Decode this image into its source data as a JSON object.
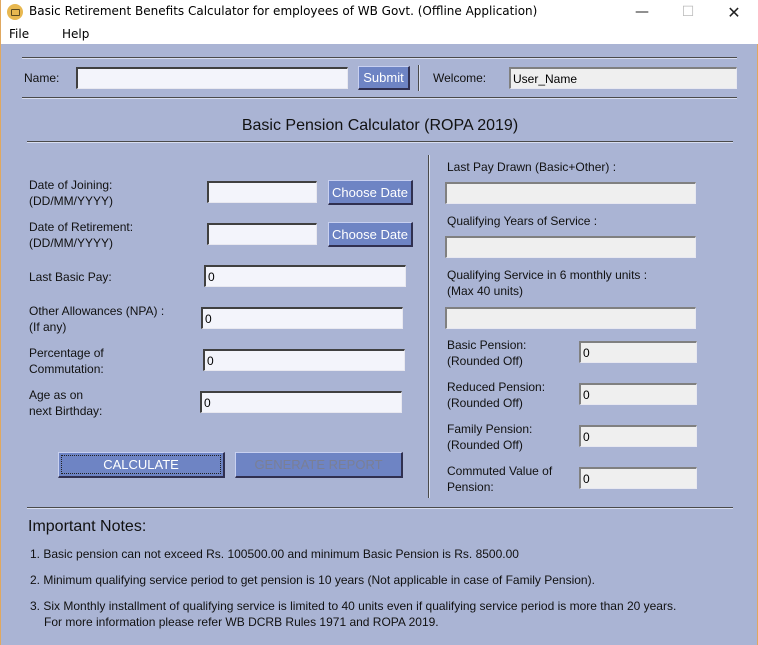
{
  "window": {
    "title": "Basic Retirement Benefits Calculator for employees of WB Govt. (Offline Application)",
    "icon": "app-icon",
    "controls": {
      "minimize": "—",
      "maximize": "☐",
      "close": "✕"
    }
  },
  "menu": {
    "items": [
      "File",
      "Help"
    ]
  },
  "login": {
    "name_label": "Name:",
    "name_value": "",
    "submit_label": "Submit",
    "welcome_label": "Welcome:",
    "welcome_value": "User_Name"
  },
  "section_title": "Basic Pension Calculator (ROPA 2019)",
  "inputs": {
    "doj_label_1": "Date of Joining:",
    "doj_label_2": "(DD/MM/YYYY)",
    "doj_value": "",
    "doj_button": "Choose Date",
    "dor_label_1": "Date of Retirement:",
    "dor_label_2": "(DD/MM/YYYY)",
    "dor_value": "",
    "dor_button": "Choose Date",
    "basic_label": "Last Basic Pay:",
    "basic_value": "0",
    "npa_label_1": "Other Allowances (NPA) :",
    "npa_label_2": "(If any)",
    "npa_value": "0",
    "commutation_label_1": "Percentage of",
    "commutation_label_2": "Commutation:",
    "commutation_value": "0",
    "age_label_1": "Age as on",
    "age_label_2": "next Birthday:",
    "age_value": "0",
    "calculate_label": "CALCULATE",
    "report_label": "GENERATE REPORT"
  },
  "outputs": {
    "last_pay_label": "Last Pay Drawn (Basic+Other) :",
    "last_pay_value": "",
    "qys_label": "Qualifying Years of Service :",
    "qys_value": "",
    "units_label_1": "Qualifying Service in 6 monthly units :",
    "units_label_2": "(Max 40 units)",
    "units_value": "",
    "basic_pension_label_1": "Basic Pension:",
    "basic_pension_label_2": "(Rounded Off)",
    "basic_pension_value": "0",
    "reduced_pension_label_1": "Reduced Pension:",
    "reduced_pension_label_2": "(Rounded Off)",
    "reduced_pension_value": "0",
    "family_pension_label_1": "Family Pension:",
    "family_pension_label_2": "(Rounded Off)",
    "family_pension_value": "0",
    "commuted_label_1": "Commuted Value of",
    "commuted_label_2": "Pension:",
    "commuted_value": "0"
  },
  "notes": {
    "title": "Important Notes:",
    "items": [
      "1. Basic pension can not exceed Rs. 100500.00 and minimum Basic Pension is Rs. 8500.00",
      "2. Minimum qualifying service period to get pension is 10 years (Not applicable in case of Family Pension).",
      "3. Six Monthly installment of qualifying service is limited to 40 units even if qualifying service period is more than 20 years.",
      "For more information please refer WB DCRB Rules 1971 and ROPA 2019."
    ]
  },
  "colors": {
    "background": "#aab4d4",
    "button": "#6e84c4",
    "input_bg": "#f3f4fb",
    "readonly_bg": "#efefef"
  }
}
